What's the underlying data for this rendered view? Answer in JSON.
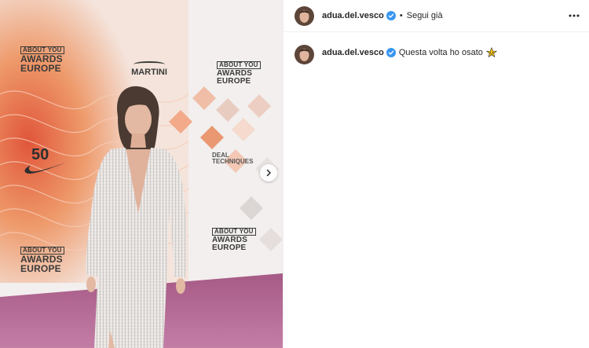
{
  "post": {
    "username": "adua.del.vesco",
    "follow_label": "Segui già",
    "separator": "•",
    "caption": "Questa volta ho osato",
    "caption_emoji": "star-struck-emoji"
  },
  "media": {
    "logos": {
      "about_you_box": "ABOUT YOU",
      "awards": "AWARDS",
      "europe": "EUROPE",
      "martini": "MARTINI",
      "deal_1": "DEAL",
      "deal_2": "TECHNIQUES",
      "nike_number": "50"
    }
  },
  "icons": {
    "verified": "verified-badge-icon",
    "more": "more-options-icon",
    "next": "chevron-right-icon"
  },
  "colors": {
    "verified_blue": "#3897f0",
    "carpet": "#b06a93",
    "orange_pattern": "#e98a5c",
    "backdrop": "#f2efee"
  }
}
